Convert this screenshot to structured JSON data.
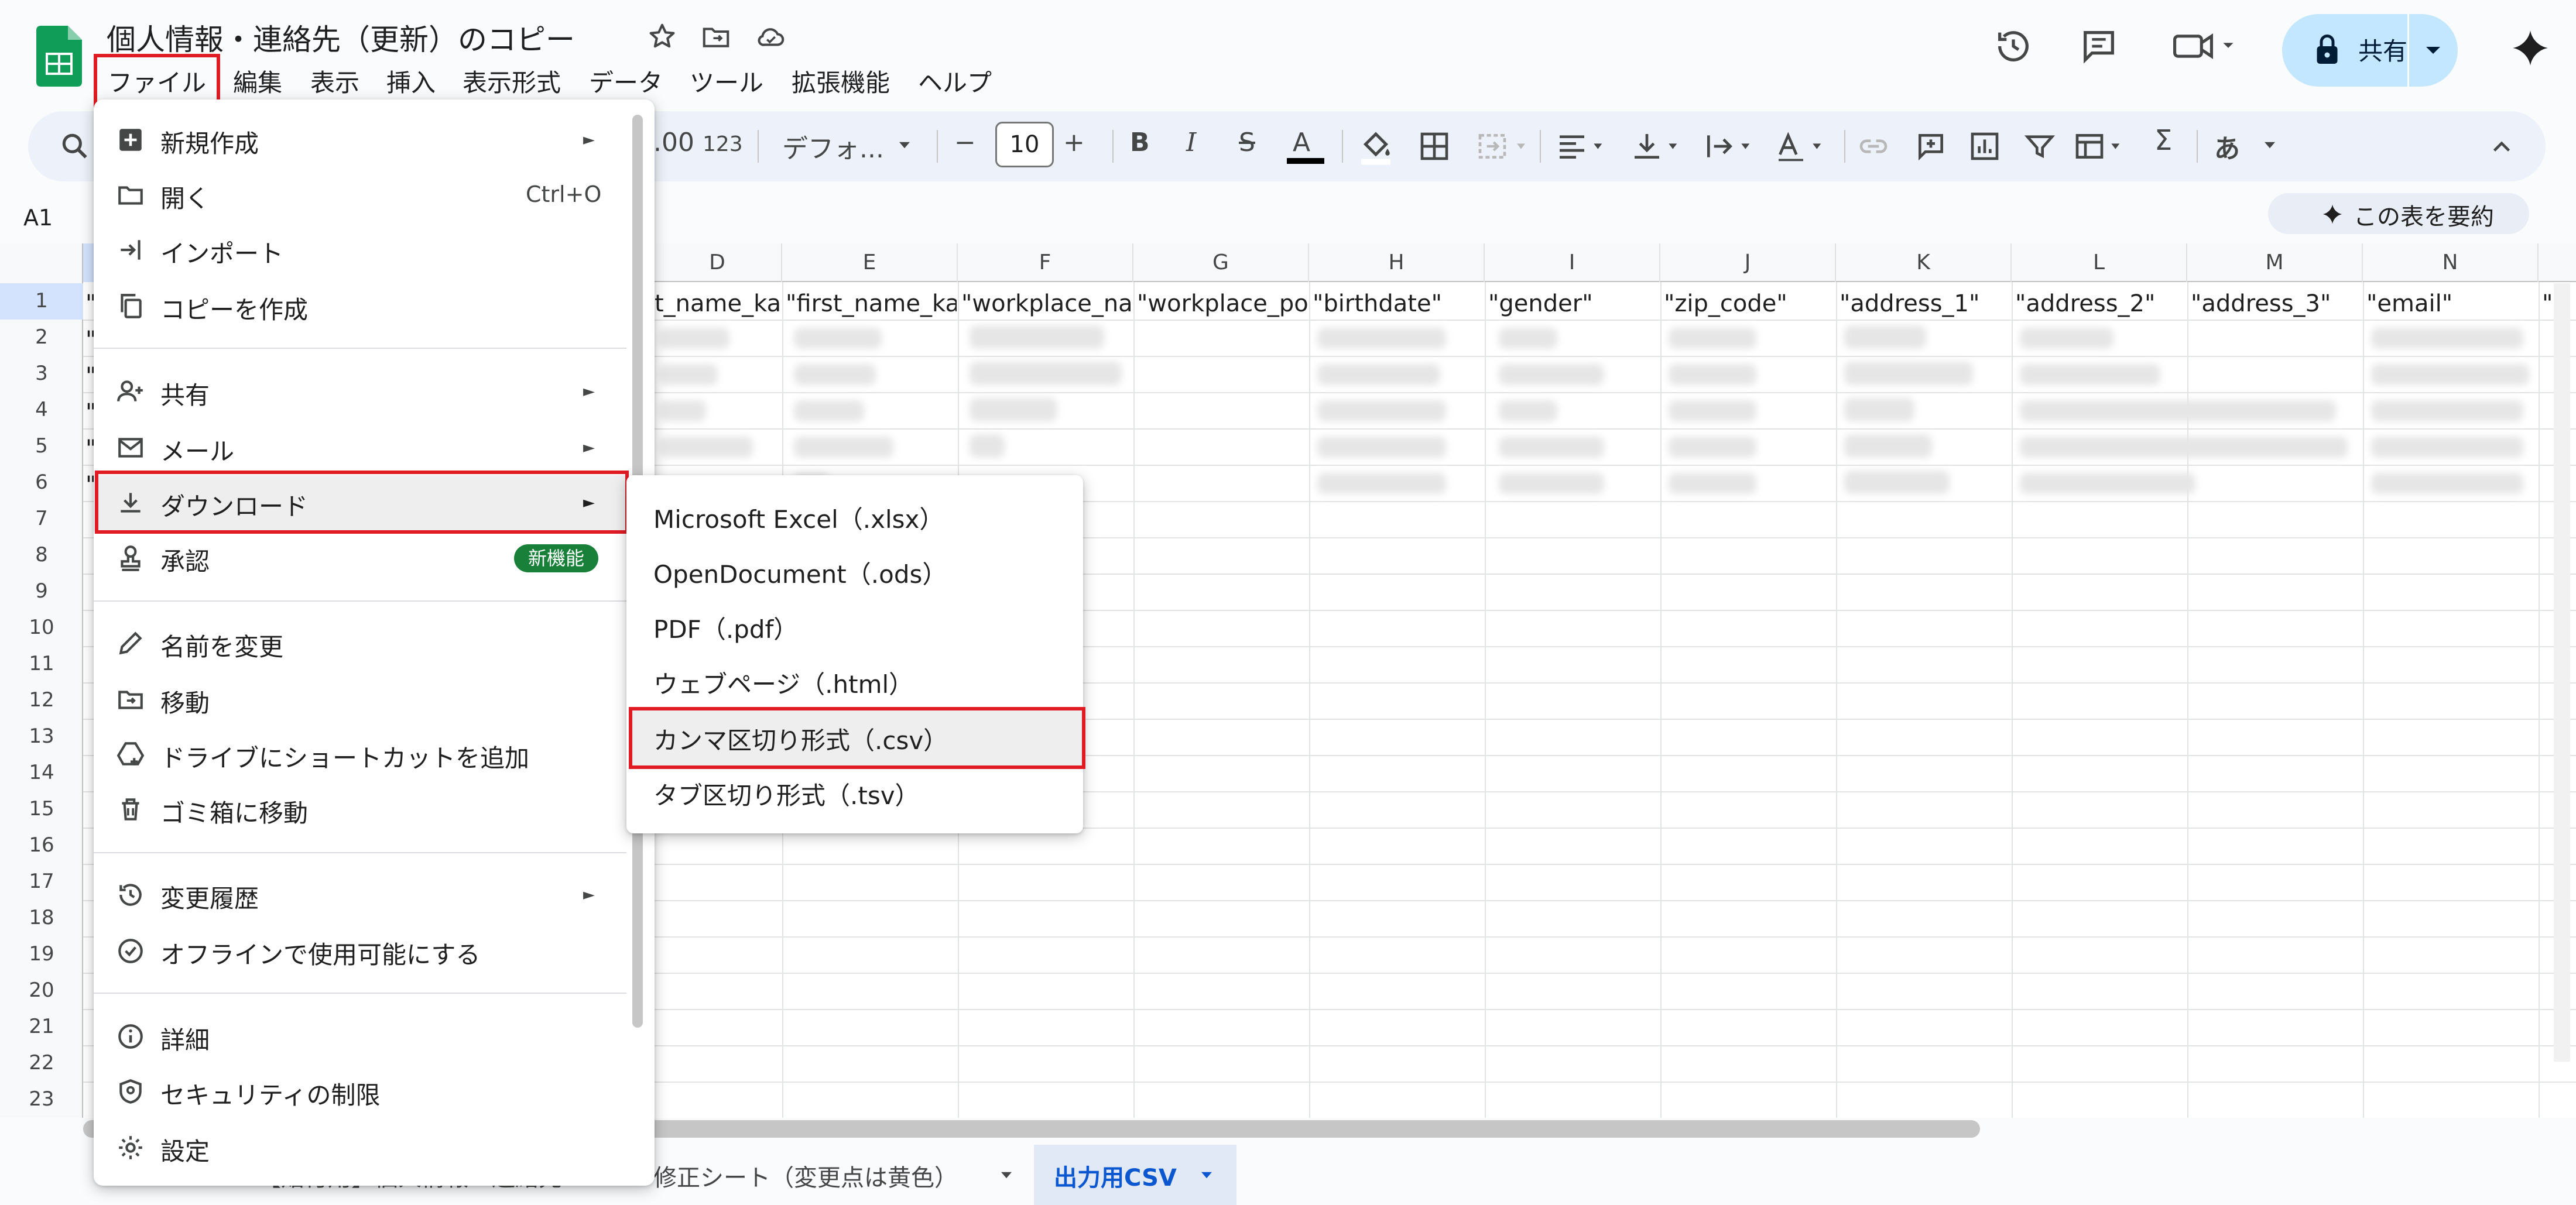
{
  "header": {
    "title": "個人情報・連絡先（更新）のコピー",
    "menu": [
      "ファイル",
      "編集",
      "表示",
      "挿入",
      "表示形式",
      "データ",
      "ツール",
      "拡張機能",
      "ヘルプ"
    ],
    "share_label": "共有"
  },
  "toolbar": {
    "number_format": "123",
    "font_name": "デフォ...",
    "font_size": "10"
  },
  "formula_bar": {
    "cell_ref": "A1",
    "summarize_label": "この表を要約"
  },
  "grid": {
    "columns": [
      "D",
      "E",
      "F",
      "G",
      "H",
      "I",
      "J",
      "K",
      "L",
      "M",
      "N"
    ],
    "rows": [
      "1",
      "2",
      "3",
      "4",
      "5",
      "6",
      "7",
      "8",
      "9",
      "10",
      "11",
      "12",
      "13",
      "14",
      "15",
      "16",
      "17",
      "18",
      "19",
      "20",
      "21",
      "22",
      "23"
    ],
    "row1": [
      "\"",
      "t_name_kana",
      "\"first_name_kana",
      "\"workplace_name",
      "\"workplace_posi",
      "\"birthdate\"",
      "\"gender\"",
      "\"zip_code\"",
      "\"address_1\"",
      "\"address_2\"",
      "\"address_3\"",
      "\"email\"",
      "\""
    ],
    "col_a_quotes": [
      "\"",
      "\"",
      "\"",
      "\"",
      "\""
    ]
  },
  "file_menu": {
    "items": [
      {
        "label": "新規作成",
        "icon": "plus-box-icon",
        "submenu": true
      },
      {
        "label": "開く",
        "icon": "folder-icon",
        "shortcut": "Ctrl+O"
      },
      {
        "label": "インポート",
        "icon": "import-icon"
      },
      {
        "label": "コピーを作成",
        "icon": "copy-icon"
      },
      {
        "label": "共有",
        "icon": "person-add-icon",
        "submenu": true
      },
      {
        "label": "メール",
        "icon": "mail-icon",
        "submenu": true
      },
      {
        "label": "ダウンロード",
        "icon": "download-icon",
        "submenu": true
      },
      {
        "label": "承認",
        "icon": "stamp-icon",
        "badge": "新機能"
      },
      {
        "label": "名前を変更",
        "icon": "pencil-icon"
      },
      {
        "label": "移動",
        "icon": "folder-move-icon"
      },
      {
        "label": "ドライブにショートカットを追加",
        "icon": "drive-shortcut-icon"
      },
      {
        "label": "ゴミ箱に移動",
        "icon": "trash-icon"
      },
      {
        "label": "変更履歴",
        "icon": "history-icon",
        "submenu": true
      },
      {
        "label": "オフラインで使用可能にする",
        "icon": "offline-icon"
      },
      {
        "label": "詳細",
        "icon": "info-icon"
      },
      {
        "label": "セキュリティの制限",
        "icon": "shield-icon"
      },
      {
        "label": "設定",
        "icon": "settings-icon"
      }
    ]
  },
  "download_submenu": {
    "items": [
      "Microsoft Excel（.xlsx）",
      "OpenDocument（.ods）",
      "PDF（.pdf）",
      "ウェブページ（.html）",
      "カンマ区切り形式（.csv）",
      "タブ区切り形式（.tsv）"
    ]
  },
  "sheet_tabs": {
    "tabs": [
      "【貼付用】個人情報・連絡先",
      "修正シート（変更点は黄色）",
      "出力用CSV"
    ],
    "active_index": 2
  },
  "colors": {
    "accent": "#0b57d0",
    "share_bg": "#c2e7ff",
    "annotation_red": "#e01b24",
    "badge_green": "#188038"
  }
}
